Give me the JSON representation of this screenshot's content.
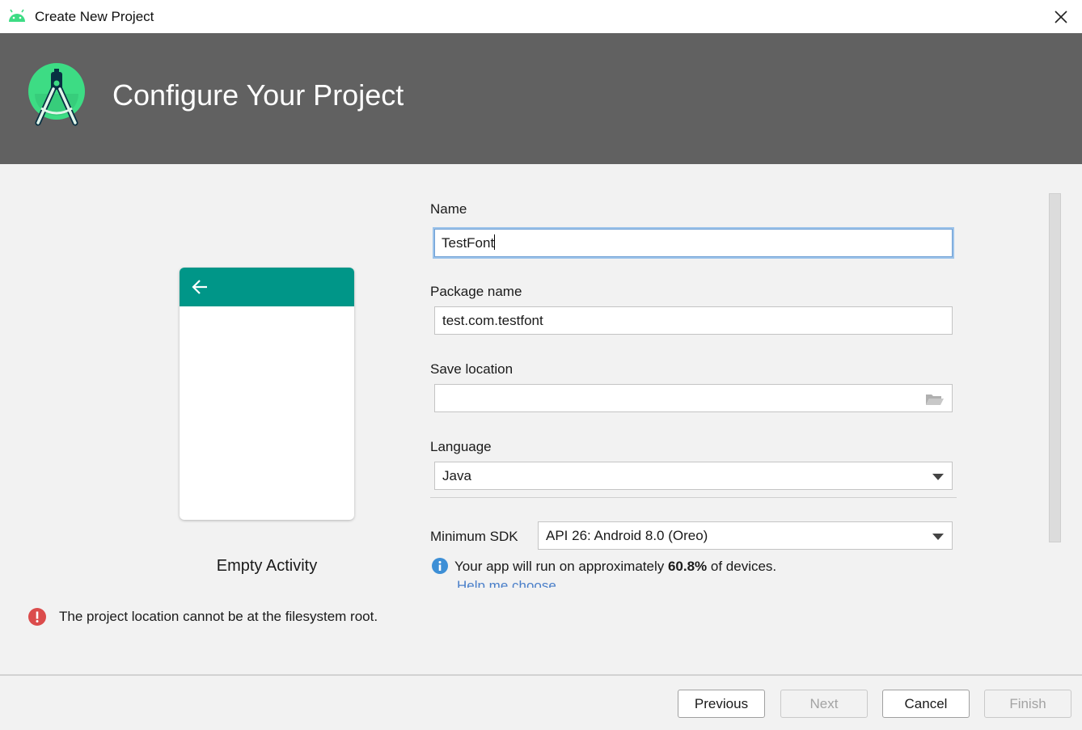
{
  "window": {
    "title": "Create New Project",
    "icon": "android-icon"
  },
  "header": {
    "heading": "Configure Your Project",
    "logo": "android-studio-logo"
  },
  "preview": {
    "template_label": "Empty Activity",
    "appbar_color": "#009688",
    "back_icon": "arrow-left-icon"
  },
  "form": {
    "name": {
      "label": "Name",
      "value": "TestFont"
    },
    "package_name": {
      "label": "Package name",
      "value": "test.com.testfont"
    },
    "save_location": {
      "label": "Save location",
      "value": "",
      "browse_icon": "folder-icon"
    },
    "language": {
      "label": "Language",
      "selected": "Java"
    },
    "minimum_sdk": {
      "label": "Minimum SDK",
      "selected": "API 26: Android 8.0 (Oreo)"
    },
    "sdk_info": {
      "prefix": "Your app will run on approximately ",
      "percent": "60.8%",
      "suffix": " of devices."
    },
    "help_link": "Help me choose"
  },
  "error": {
    "message": "The project location cannot be at the filesystem root.",
    "color": "#db4c4c"
  },
  "buttons": {
    "previous": "Previous",
    "next": "Next",
    "cancel": "Cancel",
    "finish": "Finish"
  },
  "colors": {
    "banner": "#616161",
    "accent_green": "#3ddc84",
    "focus": "#6f9fd4",
    "link": "#4a7fc9"
  }
}
